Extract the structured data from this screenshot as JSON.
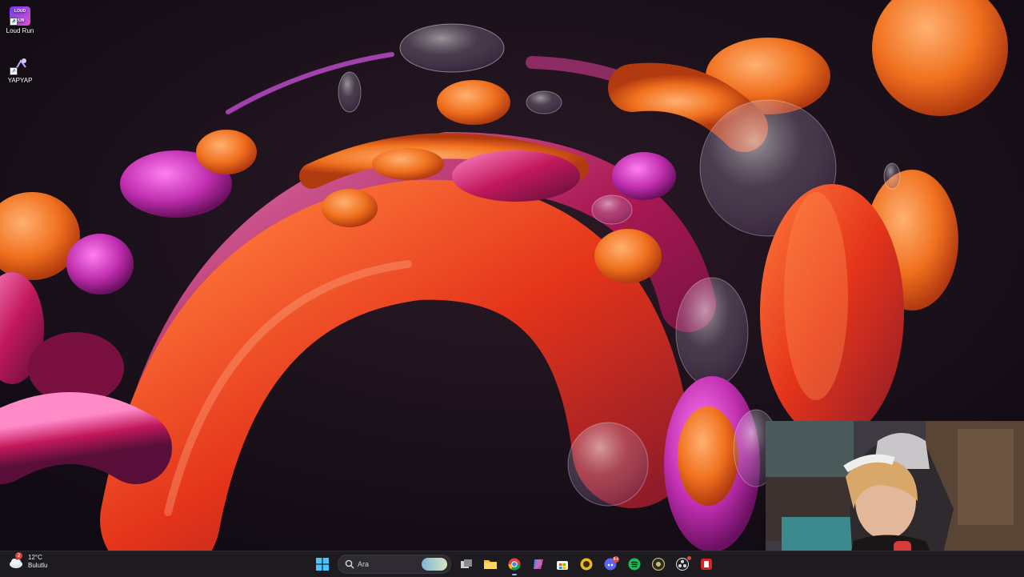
{
  "desktop": {
    "icons": [
      {
        "label": "Loud Run",
        "icon": "loud-run-game-icon",
        "badge": "LOUD RUN"
      },
      {
        "label": "YAPYAP",
        "icon": "yapyap-game-icon"
      }
    ]
  },
  "taskbar": {
    "weather": {
      "temperature": "12°C",
      "condition": "Bulutlu",
      "alerts": "2",
      "icon": "cloud-weather-icon"
    },
    "search": {
      "placeholder": "Ara"
    },
    "apps": [
      {
        "name": "start-button",
        "icon": "windows-icon"
      },
      {
        "name": "task-view",
        "icon": "task-view-icon"
      },
      {
        "name": "file-explorer",
        "icon": "folder-icon"
      },
      {
        "name": "chrome",
        "icon": "chrome-icon"
      },
      {
        "name": "copilot",
        "icon": "copilot-icon"
      },
      {
        "name": "microsoft-store",
        "icon": "store-icon"
      },
      {
        "name": "app-yellow",
        "icon": "yellow-app-icon"
      },
      {
        "name": "discord",
        "icon": "discord-icon",
        "badge": "9+"
      },
      {
        "name": "spotify",
        "icon": "spotify-icon"
      },
      {
        "name": "app-circle",
        "icon": "circle-app-icon"
      },
      {
        "name": "obs",
        "icon": "obs-icon"
      },
      {
        "name": "app-red",
        "icon": "red-app-icon"
      }
    ]
  },
  "colors": {
    "taskbar_bg": "#1d1a20",
    "wallpaper_bg": "#140d17",
    "accent_orange": "#f06a1e",
    "accent_magenta": "#c02fa8"
  }
}
